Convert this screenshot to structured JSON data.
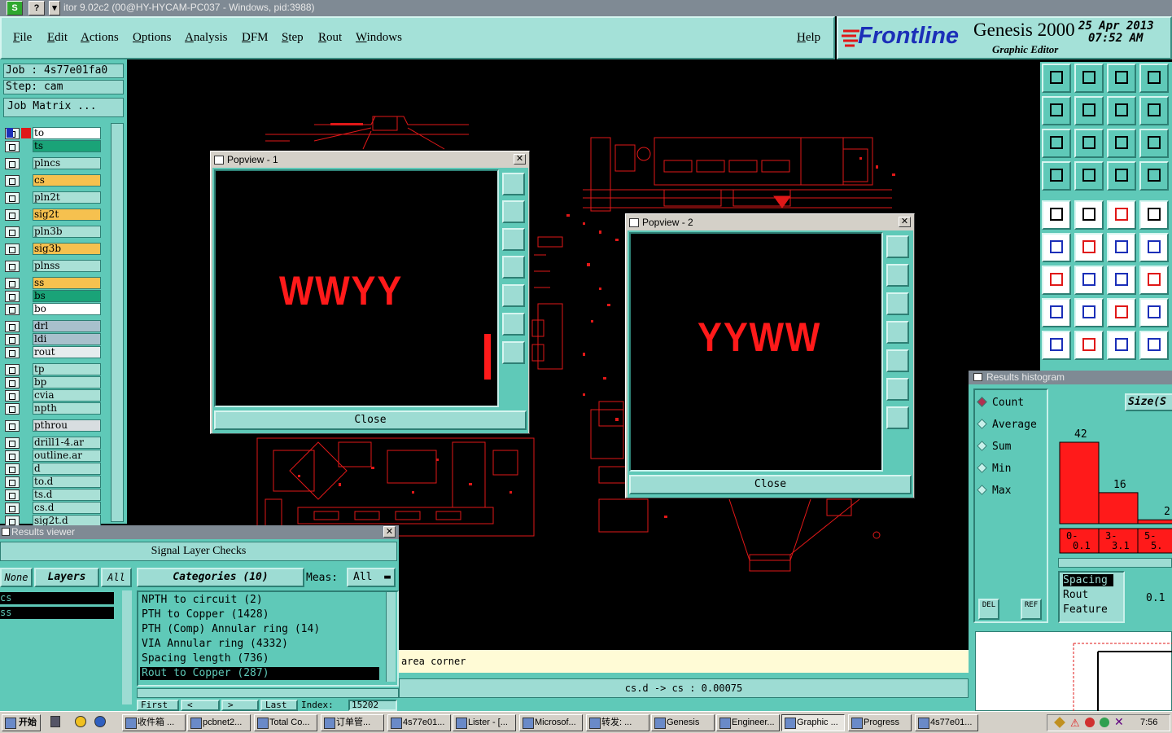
{
  "window": {
    "title": "itor 9.02c2 (00@HY-HYCAM-PC037 - Windows, pid:3988)",
    "icon_s": "S",
    "icon_q": "?"
  },
  "menu": [
    "File",
    "Edit",
    "Actions",
    "Options",
    "Analysis",
    "DFM",
    "Step",
    "Rout",
    "Windows"
  ],
  "help": "Help",
  "brand": {
    "logo": "Frontline",
    "product": "Genesis 2000",
    "subtitle": "Graphic Editor",
    "date": "25 Apr 2013",
    "time": "07:52  AM"
  },
  "job": {
    "job_line": "Job : 4s77e01fa0",
    "step_line": "Step: cam",
    "matrix_button": "Job Matrix ..."
  },
  "layers": [
    {
      "name": "to",
      "color": "#ffffff",
      "sel": true
    },
    {
      "name": "ts",
      "color": "#1aa378"
    },
    {
      "name": "plncs",
      "color": "#a9e0d6"
    },
    {
      "name": "cs",
      "color": "#f6c14f"
    },
    {
      "name": "pln2t",
      "color": "#a9e0d6"
    },
    {
      "name": "sig2t",
      "color": "#f6c14f"
    },
    {
      "name": "pln3b",
      "color": "#a9e0d6"
    },
    {
      "name": "sig3b",
      "color": "#f6c14f"
    },
    {
      "name": "plnss",
      "color": "#a9e0d6"
    },
    {
      "name": "ss",
      "color": "#f6c14f"
    },
    {
      "name": "bs",
      "color": "#1aa378"
    },
    {
      "name": "bo",
      "color": "#ffffff"
    },
    {
      "name": "drl",
      "color": "#a8c0cc"
    },
    {
      "name": "ldi",
      "color": "#a8c0cc"
    },
    {
      "name": "rout",
      "color": "#e6ecee"
    },
    {
      "name": "tp",
      "color": "#a9e0d6"
    },
    {
      "name": "bp",
      "color": "#a9e0d6"
    },
    {
      "name": "cvia",
      "color": "#a9e0d6"
    },
    {
      "name": "npth",
      "color": "#a9e0d6"
    },
    {
      "name": "pthrou",
      "color": "#d8dde0"
    },
    {
      "name": "drill1-4.ar",
      "color": "#a9e0d6"
    },
    {
      "name": "outline.ar",
      "color": "#a9e0d6"
    },
    {
      "name": "d",
      "color": "#a9e0d6"
    },
    {
      "name": "to.d",
      "color": "#a9e0d6"
    },
    {
      "name": "ts.d",
      "color": "#a9e0d6"
    },
    {
      "name": "cs.d",
      "color": "#a9e0d6"
    },
    {
      "name": "sig2t.d",
      "color": "#a9e0d6"
    }
  ],
  "popview1": {
    "title": "Popview - 1",
    "text": "WWYY",
    "close": "Close"
  },
  "popview2": {
    "title": "Popview - 2",
    "text": "YYWW",
    "close": "Close"
  },
  "results_viewer": {
    "title": "Results viewer",
    "heading": "Signal Layer Checks",
    "none_btn": "None",
    "layers_btn": "Layers",
    "all_btn": "All",
    "categories_btn": "Categories (10)",
    "meas_label": "Meas:",
    "meas_value": "All",
    "layer_list": [
      "cs",
      "ss"
    ],
    "categories": [
      "NPTH to circuit (2)",
      "PTH to Copper (1428)",
      "PTH (Comp) Annular ring (14)",
      "VIA Annular ring (4332)",
      "Spacing length (736)",
      "Rout to Copper (287)"
    ],
    "selected_category": 5,
    "first_btn": "First",
    "prev_btn": "<",
    "next_btn": ">",
    "last_btn": "Last",
    "index_label": "Index:",
    "index_value": "15202"
  },
  "histogram": {
    "title": "Results histogram",
    "options": [
      "Count",
      "Average",
      "Sum",
      "Min",
      "Max"
    ],
    "selected_option": 0,
    "size_label": "Size(S",
    "bars": [
      42,
      16,
      2
    ],
    "bins": [
      "0-\n0.1",
      "3-\n3.1",
      "5-\n5."
    ],
    "measures": [
      "Spacing",
      "Rout",
      "Feature"
    ],
    "value": "0.1",
    "del_btn": "DEL",
    "ref_btn": "REF"
  },
  "messages": {
    "prompt": "area corner",
    "status": "cs.d -> cs : 0.00075"
  },
  "taskbar": {
    "start": "开始",
    "tasks": [
      "收件箱 ...",
      "pcbnet2...",
      "Total Co...",
      "订单管...",
      "4s77e01...",
      "Lister - [...",
      "Microsof...",
      "转发: ...",
      "Genesis",
      "Engineer...",
      "Graphic ...",
      "Progress",
      "4s77e01..."
    ],
    "active_task": 10,
    "clock": "7:56"
  }
}
